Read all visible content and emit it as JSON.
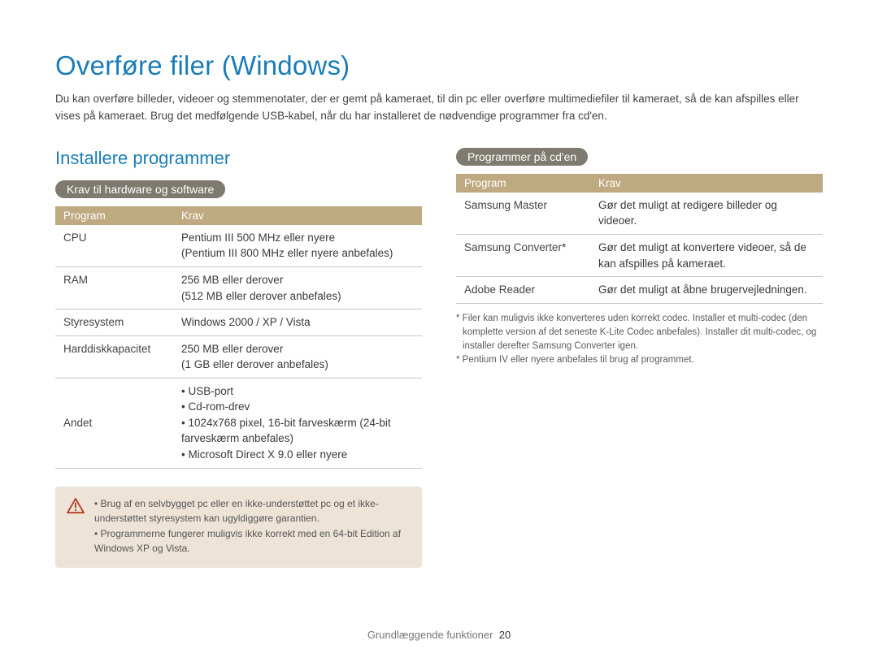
{
  "page_title": "Overføre filer (Windows)",
  "intro": "Du kan overføre billeder, videoer og stemmenotater, der er gemt på kameraet, til din pc eller overføre multimediefiler til kameraet, så de kan afspilles eller vises på kameraet. Brug det medfølgende USB-kabel, når du har installeret de nødvendige programmer fra cd'en.",
  "left": {
    "section_title": "Installere programmer",
    "pill": "Krav til hardware og software",
    "table": {
      "headers": [
        "Program",
        "Krav"
      ],
      "rows": {
        "cpu": {
          "label": "CPU",
          "value": "Pentium III 500 MHz eller nyere\n(Pentium III 800 MHz eller nyere anbefales)"
        },
        "ram": {
          "label": "RAM",
          "value": "256 MB eller derover\n(512 MB eller derover anbefales)"
        },
        "os": {
          "label": "Styresystem",
          "value": "Windows 2000 / XP / Vista"
        },
        "hdd": {
          "label": "Harddiskkapacitet",
          "value": "250 MB eller derover\n(1 GB eller derover anbefales)"
        },
        "other": {
          "label": "Andet",
          "bullets": [
            "USB-port",
            "Cd-rom-drev",
            "1024x768 pixel, 16-bit farveskærm (24-bit farveskærm anbefales)",
            "Microsoft Direct X 9.0 eller nyere"
          ]
        }
      }
    },
    "warning": {
      "items": [
        "Brug af en selvbygget pc eller en ikke-understøttet pc og et ikke-understøttet styresystem kan ugyldiggøre garantien.",
        "Programmerne fungerer muligvis ikke korrekt med en 64-bit Edition af Windows XP og Vista."
      ]
    }
  },
  "right": {
    "pill": "Programmer på cd'en",
    "table": {
      "headers": [
        "Program",
        "Krav"
      ],
      "rows": {
        "master": {
          "label": "Samsung Master",
          "value": "Gør det muligt at redigere billeder og videoer."
        },
        "converter": {
          "label": "Samsung Converter*",
          "value": "Gør det muligt at konvertere videoer, så de kan afspilles på kameraet."
        },
        "adobe": {
          "label": "Adobe Reader",
          "value": "Gør det muligt at åbne brugervejledningen."
        }
      }
    },
    "footnotes": [
      "* Filer kan muligvis ikke konverteres uden korrekt codec. Installer et multi-codec (den komplette version af det seneste K-Lite Codec anbefales). Installer dit multi-codec, og installer derefter Samsung Converter igen.",
      "* Pentium IV eller nyere anbefales til brug af programmet."
    ]
  },
  "footer": {
    "text": "Grundlæggende funktioner",
    "page": "20"
  }
}
